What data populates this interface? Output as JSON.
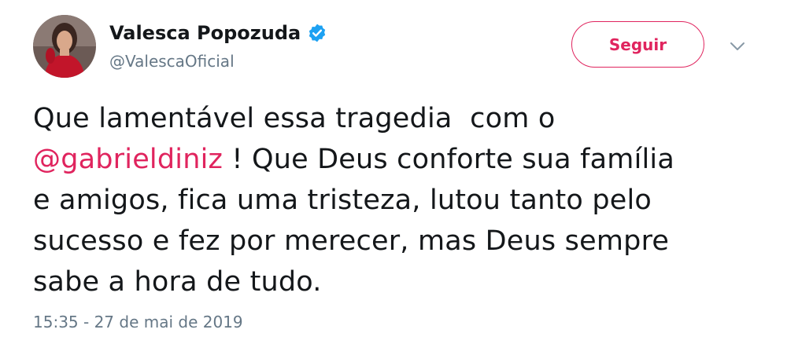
{
  "user": {
    "display_name": "Valesca Popozuda",
    "handle": "@ValescaOficial",
    "verified": true
  },
  "follow_button": {
    "label": "Seguir"
  },
  "tweet": {
    "line1": "Que lamentável essa tragedia  com o",
    "mention": "@gabrieldiniz",
    "line2_rest": " ! Que Deus conforte sua família",
    "line3": "e amigos, fica uma tristeza, lutou tanto pelo",
    "line4": "sucesso e fez por merecer, mas Deus sempre",
    "line5": "sabe a hora de tudo."
  },
  "timestamp": "15:35 - 27 de mai de 2019",
  "colors": {
    "accent": "#e0245e",
    "verified": "#1da1f2",
    "secondary_text": "#657786",
    "primary_text": "#14171a"
  },
  "icons": {
    "verified": "verified-badge-icon",
    "caret": "chevron-down-icon",
    "avatar": "profile-photo"
  }
}
